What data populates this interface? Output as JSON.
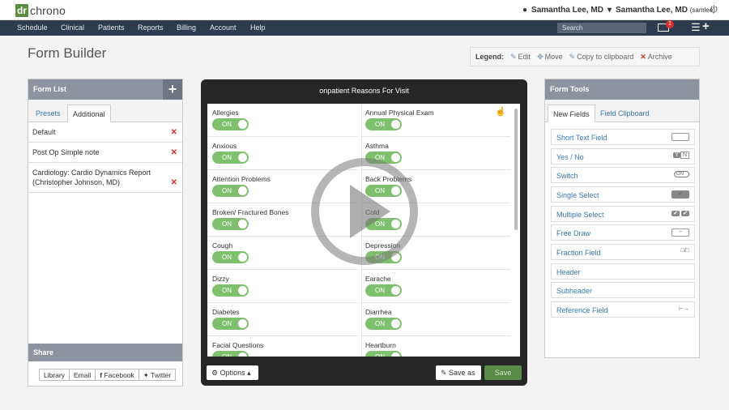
{
  "brand": {
    "box": "dr",
    "text": "chrono"
  },
  "user": {
    "name1": "Samantha Lee, MD",
    "name2": "Samantha Lee, MD",
    "username": "(samlee)"
  },
  "nav": [
    "Schedule",
    "Clinical",
    "Patients",
    "Reports",
    "Billing",
    "Account",
    "Help"
  ],
  "search": {
    "placeholder": "Search"
  },
  "mail_count": "1",
  "page_title": "Form Builder",
  "legend": {
    "label": "Legend:",
    "edit": "Edit",
    "move": "Move",
    "copy": "Copy to clipboard",
    "archive": "Archive"
  },
  "form_list": {
    "title": "Form List",
    "tabs": [
      "Presets",
      "Additional"
    ],
    "active_tab": "Additional",
    "items": [
      "Default",
      "Post Op Simple note",
      "Cardiology: Cardio Dynamics Report (Christopher Johnson, MD)"
    ]
  },
  "share": {
    "title": "Share",
    "buttons": [
      "Library",
      "Email",
      "Facebook",
      "Twitter"
    ]
  },
  "form": {
    "title": "onpatient Reasons For Visit",
    "toggle_label": "ON",
    "left_items": [
      "Allergies",
      "Anxious",
      "Attention Problems",
      "Broken/ Fractured Bones",
      "Cough",
      "Dizzy",
      "Diabetes",
      "Facial Questions"
    ],
    "right_items": [
      "Annual Physical Exam",
      "Asthma",
      "Back Problems",
      "Cold",
      "Depression",
      "Earache",
      "Diarrhea",
      "Heartburn"
    ],
    "options_label": "Options",
    "save_as_label": "Save as",
    "save_label": "Save"
  },
  "form_tools": {
    "title": "Form Tools",
    "tabs": [
      "New Fields",
      "Field Clipboard"
    ],
    "active_tab": "New Fields",
    "items": [
      "Short Text Field",
      "Yes / No",
      "Switch",
      "Single Select",
      "Multiple Select",
      "Free Draw",
      "Fraction Field",
      "Header",
      "Subheader",
      "Reference Field"
    ],
    "yes_no_icon": [
      "Y",
      "N"
    ],
    "switch_icon": "ON"
  },
  "colors": {
    "nav_bg": "#2e3a4e",
    "brand_green": "#5b8f3d",
    "toggle_green": "#7fc06e",
    "link_blue": "#3a78b5",
    "panel_header": "#8e93a0"
  }
}
